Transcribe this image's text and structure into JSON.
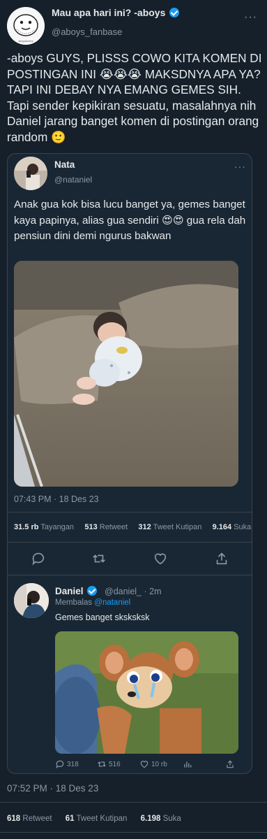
{
  "header": {
    "name": "Mau apa hari ini? -aboys",
    "handle": "@aboys_fanbase",
    "more": "···",
    "avatar_caption": "aboyslovers"
  },
  "tweet_text": "-aboys GUYS, PLISSS COWO KITA KOMEN DI POSTINGAN INI 😭😭😭 MAKSDNYA APA YA? TAPI INI DEBAY NYA EMANG GEMES SIH. Tapi sender kepikiran sesuatu, masalahnya nih Daniel jarang banget komen di postingan orang random 🙂",
  "quoted": {
    "name": "Nata",
    "handle": "@nataniel",
    "more": "···",
    "text": "Anak gua kok bisa lucu banget ya, gemes banget kaya papinya, alias gua sendiri 😍😍 gua rela dah pensiun dini demi ngurus bakwan",
    "timestamp": "07:43 PM · 18 Des 23",
    "stats": [
      {
        "value": "31.5 rb",
        "label": "Tayangan"
      },
      {
        "value": "513",
        "label": "Retweet"
      },
      {
        "value": "312",
        "label": "Tweet Kutipan"
      },
      {
        "value": "9.164",
        "label": "Suka"
      }
    ],
    "actions": [
      "reply-icon",
      "retweet-icon",
      "like-icon",
      "share-icon"
    ]
  },
  "reply": {
    "name": "Daniel",
    "handle": "@daniel_ · 2m",
    "replying_prefix": "Membalas",
    "replying_to": "@nataniel",
    "text": "Gemes banget sksksksk",
    "actions": [
      {
        "icon": "reply-icon",
        "count": "318"
      },
      {
        "icon": "retweet-icon",
        "count": "516"
      },
      {
        "icon": "like-icon",
        "count": "10 rb"
      },
      {
        "icon": "views-icon",
        "count": ""
      },
      {
        "icon": "share-icon",
        "count": ""
      }
    ]
  },
  "footer": {
    "timestamp": "07:52 PM · 18 Des 23",
    "stats": [
      {
        "value": "618",
        "label": "Retweet"
      },
      {
        "value": "61",
        "label": "Tweet Kutipan"
      },
      {
        "value": "6.198",
        "label": "Suka"
      }
    ]
  },
  "colors": {
    "background": "#15202b",
    "card": "#192734",
    "accent": "#1d9bf0",
    "muted": "#8b98a5"
  }
}
